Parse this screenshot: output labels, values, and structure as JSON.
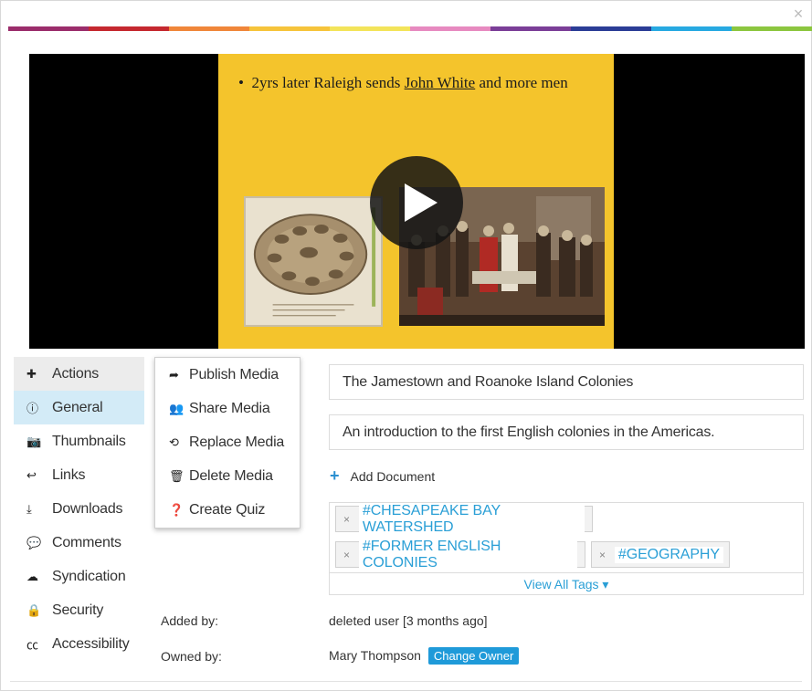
{
  "window": {
    "close_glyph": "×"
  },
  "rainbow_colors": [
    "#9b2d6b",
    "#c5282f",
    "#f0863a",
    "#f6c43b",
    "#f3e45a",
    "#e78ac0",
    "#7b3e98",
    "#2b3d96",
    "#27a9e1",
    "#8cc63f"
  ],
  "player": {
    "slide_bullet": "•",
    "slide_text_before": "2yrs later Raleigh sends ",
    "slide_text_link": "John White",
    "slide_text_after": " and more men",
    "slide_bg": "#f4c42c"
  },
  "sidebar": {
    "items": [
      {
        "icon": "plus-icon",
        "glyph": "✚",
        "label": "Actions"
      },
      {
        "icon": "info-icon",
        "glyph": "ⓘ",
        "label": "General"
      },
      {
        "icon": "camera-icon",
        "glyph": "📷",
        "label": "Thumbnails"
      },
      {
        "icon": "link-icon",
        "glyph": "↩",
        "label": "Links"
      },
      {
        "icon": "download-icon",
        "glyph": "⤓",
        "label": "Downloads"
      },
      {
        "icon": "comments-icon",
        "glyph": "💬",
        "label": "Comments"
      },
      {
        "icon": "cloud-upload-icon",
        "glyph": "☁",
        "label": "Syndication"
      },
      {
        "icon": "lock-icon",
        "glyph": "🔒",
        "label": "Security"
      },
      {
        "icon": "cc-icon",
        "glyph": "㏄",
        "label": "Accessibility"
      }
    ]
  },
  "actions_menu": {
    "items": [
      {
        "icon": "share-arrow-icon",
        "glyph": "➦",
        "label": "Publish Media"
      },
      {
        "icon": "user-plus-icon",
        "glyph": "👥",
        "label": "Share Media"
      },
      {
        "icon": "retweet-icon",
        "glyph": "⟲",
        "label": "Replace Media"
      },
      {
        "icon": "trash-icon",
        "glyph": "🗑",
        "label": "Delete Media"
      },
      {
        "icon": "question-circle-icon",
        "glyph": "❓",
        "label": "Create Quiz"
      }
    ]
  },
  "main": {
    "title": "The Jamestown and Roanoke Island Colonies",
    "description": "An introduction to the first English colonies in the Americas.",
    "add_document": "Add Document",
    "tags": [
      "#CHESAPEAKE BAY WATERSHED",
      "#FORMER ENGLISH COLONIES",
      "#GEOGRAPHY"
    ],
    "tag_remove_glyph": "×",
    "view_all_tags": "View All Tags ▾",
    "added_by_label": "Added by:",
    "added_by_value": "deleted user [3 months ago]",
    "owned_by_label": "Owned by:",
    "owned_by_value": "Mary Thompson",
    "change_owner": "Change Owner"
  }
}
